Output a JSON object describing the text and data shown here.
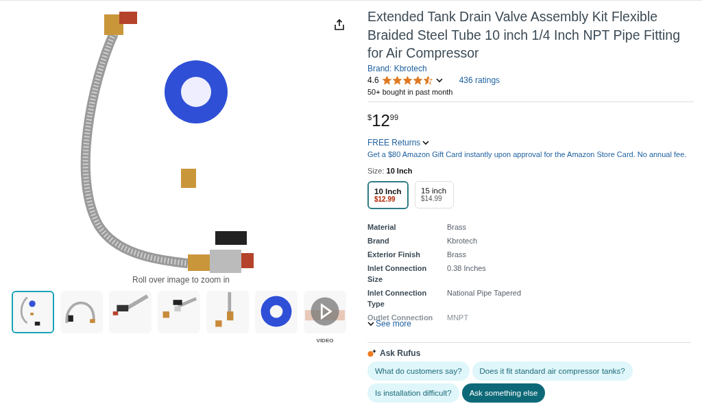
{
  "gallery": {
    "zoom_hint": "Roll over image to zoom in",
    "thumbnails": [
      {
        "kind": "image",
        "selected": true
      },
      {
        "kind": "image",
        "selected": false
      },
      {
        "kind": "image",
        "selected": false
      },
      {
        "kind": "image",
        "selected": false
      },
      {
        "kind": "image",
        "selected": false
      },
      {
        "kind": "image",
        "selected": false
      },
      {
        "kind": "video",
        "selected": false,
        "label": "VIDEO"
      }
    ]
  },
  "product": {
    "title": "Extended Tank Drain Valve Assembly Kit Flexible Braided Steel Tube 10 inch 1/4 Inch NPT Pipe Fitting for Air Compressor",
    "brand": "Brand: Kbrotech",
    "rating": "4.6",
    "stars": 4.5,
    "ratings_count": "436 ratings",
    "bought": "50+ bought in past month",
    "price": {
      "symbol": "$",
      "whole": "12",
      "fraction": "99"
    },
    "returns": "FREE Returns",
    "gift_card": "Get a $80 Amazon Gift Card instantly upon approval for the Amazon Store Card. No annual fee.",
    "size_label": "Size:",
    "size_value": "10 Inch",
    "sizes": [
      {
        "name": "10 Inch",
        "price": "$12.99",
        "selected": true
      },
      {
        "name": "15 inch",
        "price": "$14.99",
        "selected": false
      }
    ],
    "specs": [
      {
        "label": "Material",
        "value": "Brass",
        "faded": false
      },
      {
        "label": "Brand",
        "value": "Kbrotech",
        "faded": false
      },
      {
        "label": "Exterior Finish",
        "value": "Brass",
        "faded": false
      },
      {
        "label": "Inlet Connection Size",
        "value": "0.38 Inches",
        "faded": false
      },
      {
        "label": "Inlet Connection Type",
        "value": "National Pipe Tapered",
        "faded": false
      },
      {
        "label": "Outlet Connection",
        "value": "MNPT",
        "faded": true
      }
    ],
    "see_more": "See more"
  },
  "rufus": {
    "title": "Ask Rufus",
    "chips": [
      {
        "text": "What do customers say?",
        "kind": "question"
      },
      {
        "text": "Does it fit standard air compressor tanks?",
        "kind": "question"
      },
      {
        "text": "Is installation difficult?",
        "kind": "question"
      },
      {
        "text": "Ask something else",
        "kind": "action"
      }
    ]
  }
}
